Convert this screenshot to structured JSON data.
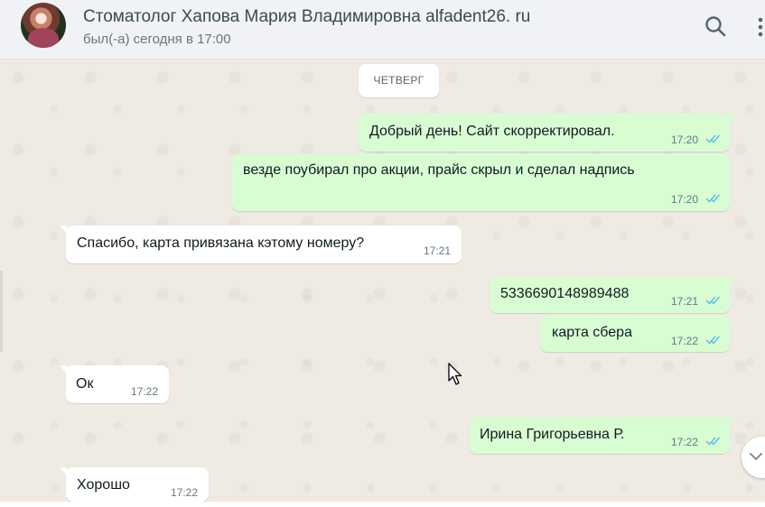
{
  "header": {
    "contact_name": "Стоматолог Хапова Мария Владимировна alfadent26. ru",
    "status": "был(-а) сегодня в 17:00",
    "icons": [
      "avatar",
      "search-icon",
      "menu-dots-icon"
    ]
  },
  "chat": {
    "day_label": "ЧЕТВЕРГ",
    "messages": [
      {
        "direction": "out",
        "text": "Добрый день! Сайт скорректировал.",
        "time": "17:20",
        "status": "read"
      },
      {
        "direction": "out",
        "text": "везде поубирал про акции, прайс скрыл и сделал надпись",
        "time": "17:20",
        "status": "read"
      },
      {
        "direction": "in",
        "text": "Спасибо, карта привязана кэтому номеру?",
        "time": "17:21"
      },
      {
        "direction": "out",
        "text": "5336690148989488",
        "time": "17:21",
        "status": "read"
      },
      {
        "direction": "out",
        "text": "карта сбера",
        "time": "17:22",
        "status": "read"
      },
      {
        "direction": "in",
        "text": "Ок",
        "time": "17:22"
      },
      {
        "direction": "out",
        "text": "Ирина Григорьевна Р.",
        "time": "17:22",
        "status": "read"
      },
      {
        "direction": "in",
        "text": "Хорошо",
        "time": "17:22"
      }
    ]
  },
  "colors": {
    "outgoing_bubble": "#d9fdd3",
    "incoming_bubble": "#ffffff",
    "read_ticks": "#53bdeb",
    "chat_background": "#efeae2",
    "header_background": "#f0f2f5"
  }
}
